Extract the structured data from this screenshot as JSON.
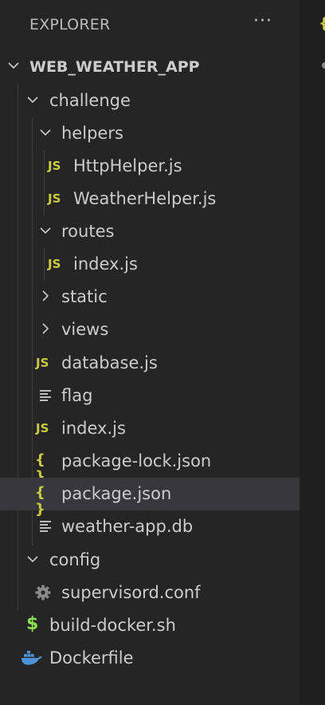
{
  "explorer": {
    "title": "EXPLORER",
    "more_glyph": "···"
  },
  "tree": {
    "root": "WEB_WEATHER_APP",
    "items": [
      {
        "label": "challenge"
      },
      {
        "label": "helpers"
      },
      {
        "label": "HttpHelper.js",
        "icon_text": "JS"
      },
      {
        "label": "WeatherHelper.js",
        "icon_text": "JS"
      },
      {
        "label": "routes"
      },
      {
        "label": "index.js",
        "icon_text": "JS"
      },
      {
        "label": "static"
      },
      {
        "label": "views"
      },
      {
        "label": "database.js",
        "icon_text": "JS"
      },
      {
        "label": "flag"
      },
      {
        "label": "index.js",
        "icon_text": "JS"
      },
      {
        "label": "package-lock.json",
        "icon_text": "{ }"
      },
      {
        "label": "package.json",
        "icon_text": "{ }"
      },
      {
        "label": "weather-app.db"
      },
      {
        "label": "config"
      },
      {
        "label": "supervisord.conf"
      },
      {
        "label": "build-docker.sh",
        "icon_text": "$"
      },
      {
        "label": "Dockerfile"
      }
    ]
  },
  "colors": {
    "js_icon": "#cbcb41",
    "json_icon": "#cbcb41",
    "shell_icon": "#89e051",
    "docker_icon": "#4c93d8",
    "selected_row": "#37373d"
  }
}
